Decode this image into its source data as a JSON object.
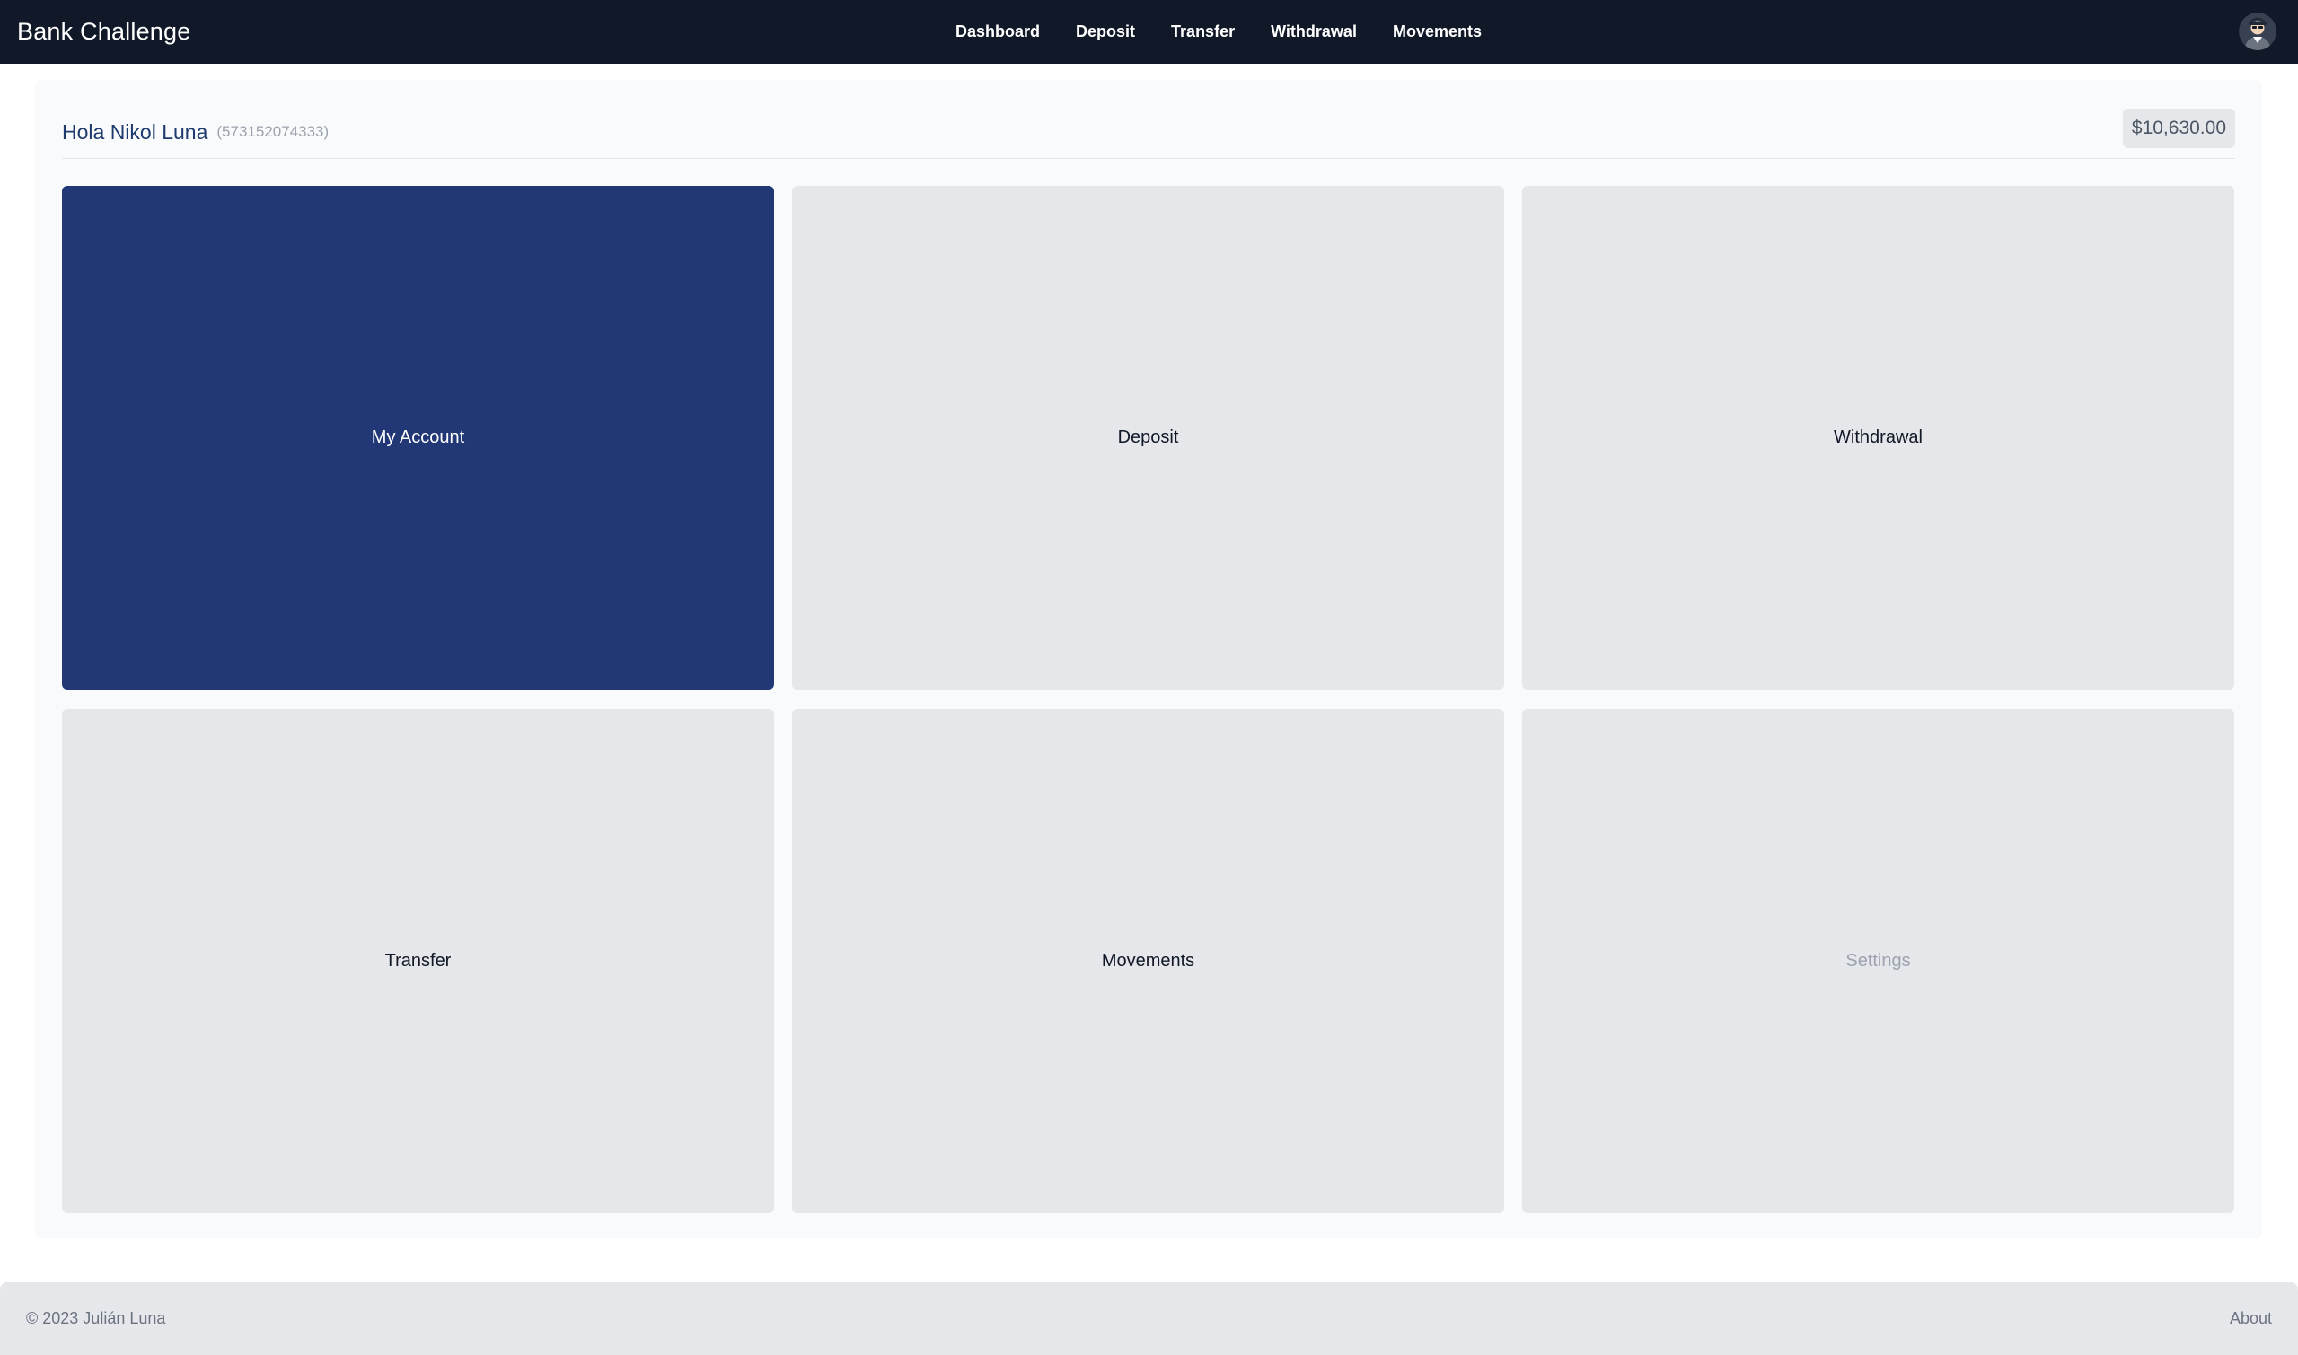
{
  "navbar": {
    "brand": "Bank Challenge",
    "links": [
      {
        "label": "Dashboard"
      },
      {
        "label": "Deposit"
      },
      {
        "label": "Transfer"
      },
      {
        "label": "Withdrawal"
      },
      {
        "label": "Movements"
      }
    ],
    "avatar_icon": "user-avatar-icon"
  },
  "header": {
    "greeting": "Hola Nikol Luna",
    "phone": "(573152074333)",
    "balance": "$10,630.00"
  },
  "tiles": [
    {
      "label": "My Account",
      "active": true
    },
    {
      "label": "Deposit"
    },
    {
      "label": "Withdrawal"
    },
    {
      "label": "Transfer"
    },
    {
      "label": "Movements"
    },
    {
      "label": "Settings",
      "disabled": true
    }
  ],
  "footer": {
    "copyright": "© 2023 Julián Luna",
    "about": "About"
  },
  "colors": {
    "navbar_bg": "#111827",
    "active_tile": "#213776",
    "tile_bg": "#e5e7eb"
  }
}
